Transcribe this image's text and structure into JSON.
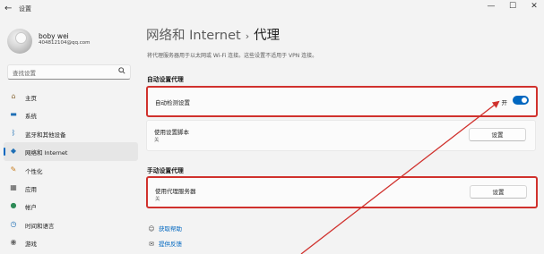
{
  "window": {
    "title": "设置",
    "back_glyph": "←",
    "minimize_glyph": "—",
    "maximize_glyph": "☐",
    "close_glyph": "✕"
  },
  "profile": {
    "name": "boby wei",
    "email": "404812104@qq.com"
  },
  "search": {
    "placeholder": "查找设置",
    "icon": "search-icon"
  },
  "sidebar": {
    "items": [
      {
        "label": "主页",
        "icon": "home-icon",
        "glyph": "⌂",
        "color": "#8a6a3a"
      },
      {
        "label": "系统",
        "icon": "monitor-icon",
        "glyph": "▬",
        "color": "#1f6fb5"
      },
      {
        "label": "蓝牙和其他设备",
        "icon": "bluetooth-icon",
        "glyph": "ᛒ",
        "color": "#1f6fb5"
      },
      {
        "label": "网络和 Internet",
        "icon": "wifi-icon",
        "glyph": "◆",
        "color": "#1f6fb5"
      },
      {
        "label": "个性化",
        "icon": "brush-icon",
        "glyph": "✎",
        "color": "#c77c1e"
      },
      {
        "label": "应用",
        "icon": "apps-icon",
        "glyph": "▦",
        "color": "#555555"
      },
      {
        "label": "帐户",
        "icon": "account-icon",
        "glyph": "●",
        "color": "#2e8b57"
      },
      {
        "label": "时间和语言",
        "icon": "globe-clock-icon",
        "glyph": "◷",
        "color": "#1f6fb5"
      },
      {
        "label": "游戏",
        "icon": "gamepad-icon",
        "glyph": "◉",
        "color": "#666666"
      }
    ],
    "active_index": 3
  },
  "header": {
    "parent": "网络和 Internet",
    "separator": "›",
    "current": "代理"
  },
  "description": "将代理服务器用于以太网或 Wi-Fi 连接。这些设置不适用于 VPN 连接。",
  "auto_proxy": {
    "section_title": "自动设置代理",
    "detect": {
      "label": "自动检测设置",
      "state_label": "开",
      "enabled": true
    },
    "script": {
      "label": "使用设置脚本",
      "status": "关",
      "button": "设置"
    }
  },
  "manual_proxy": {
    "section_title": "手动设置代理",
    "use_server": {
      "label": "使用代理服务器",
      "status": "关",
      "button": "设置"
    }
  },
  "links": [
    {
      "label": "获取帮助",
      "icon": "help-icon",
      "glyph": "☺"
    },
    {
      "label": "提供反馈",
      "icon": "feedback-icon",
      "glyph": "✉"
    }
  ],
  "colors": {
    "accent": "#0067c0",
    "annotation": "#d0312d"
  }
}
